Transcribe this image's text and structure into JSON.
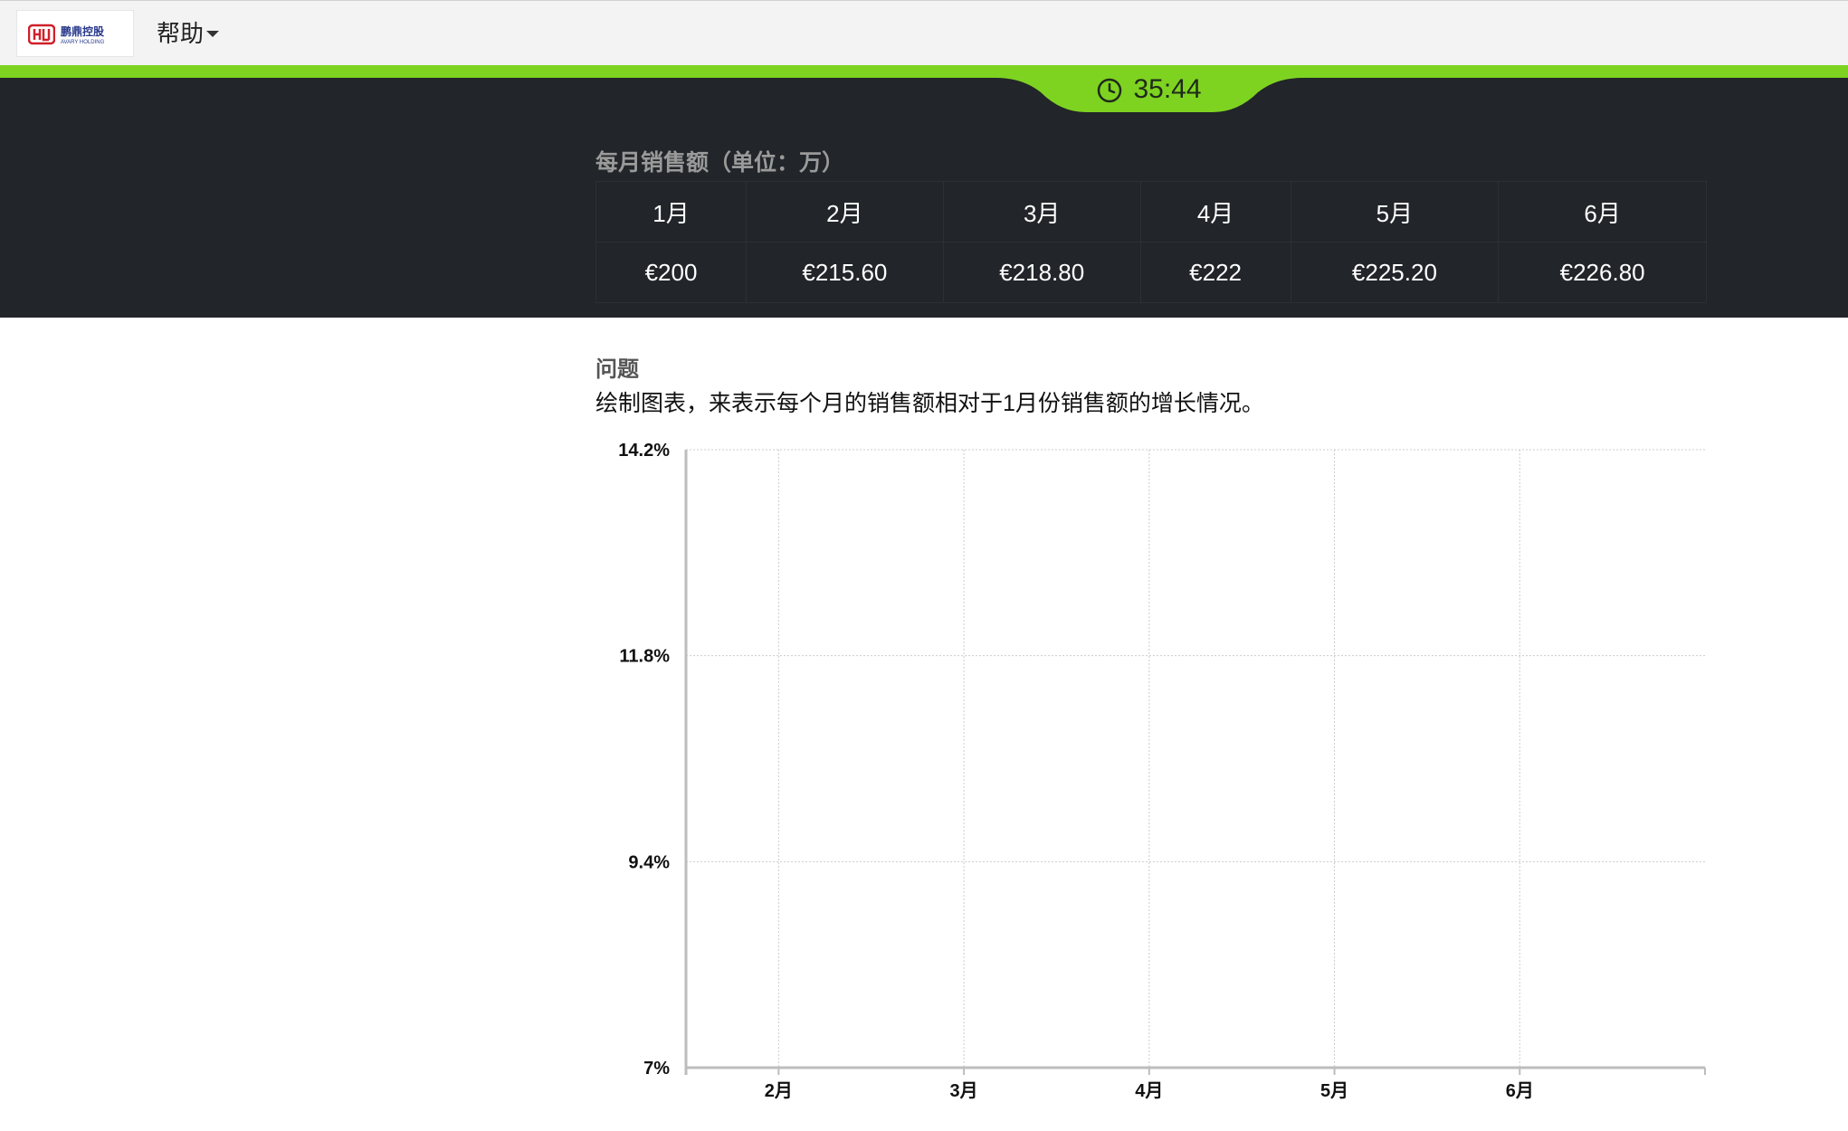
{
  "navbar": {
    "logo_text": "鹏鼎控股",
    "logo_subtext": "AVARY HOLDING",
    "help_label": "帮助"
  },
  "timer": {
    "value": "35:44"
  },
  "colors": {
    "accent_green": "#7ed321",
    "header_dark": "#222529"
  },
  "sales_table": {
    "title": "每月销售额（单位：万）",
    "months": [
      "1月",
      "2月",
      "3月",
      "4月",
      "5月",
      "6月"
    ],
    "values": [
      "€200",
      "€215.60",
      "€218.80",
      "€222",
      "€225.20",
      "€226.80"
    ]
  },
  "question": {
    "title": "问题",
    "text": "绘制图表，来表示每个月的销售额相对于1月份销售额的增长情况。"
  },
  "chart_data": {
    "type": "line",
    "categories": [
      "2月",
      "3月",
      "4月",
      "5月",
      "6月"
    ],
    "y_ticks": [
      "14.2%",
      "11.8%",
      "9.4%",
      "7%"
    ],
    "ylim": [
      7,
      14.2
    ],
    "grid": true,
    "series": [],
    "title": "",
    "xlabel": "",
    "ylabel": ""
  }
}
